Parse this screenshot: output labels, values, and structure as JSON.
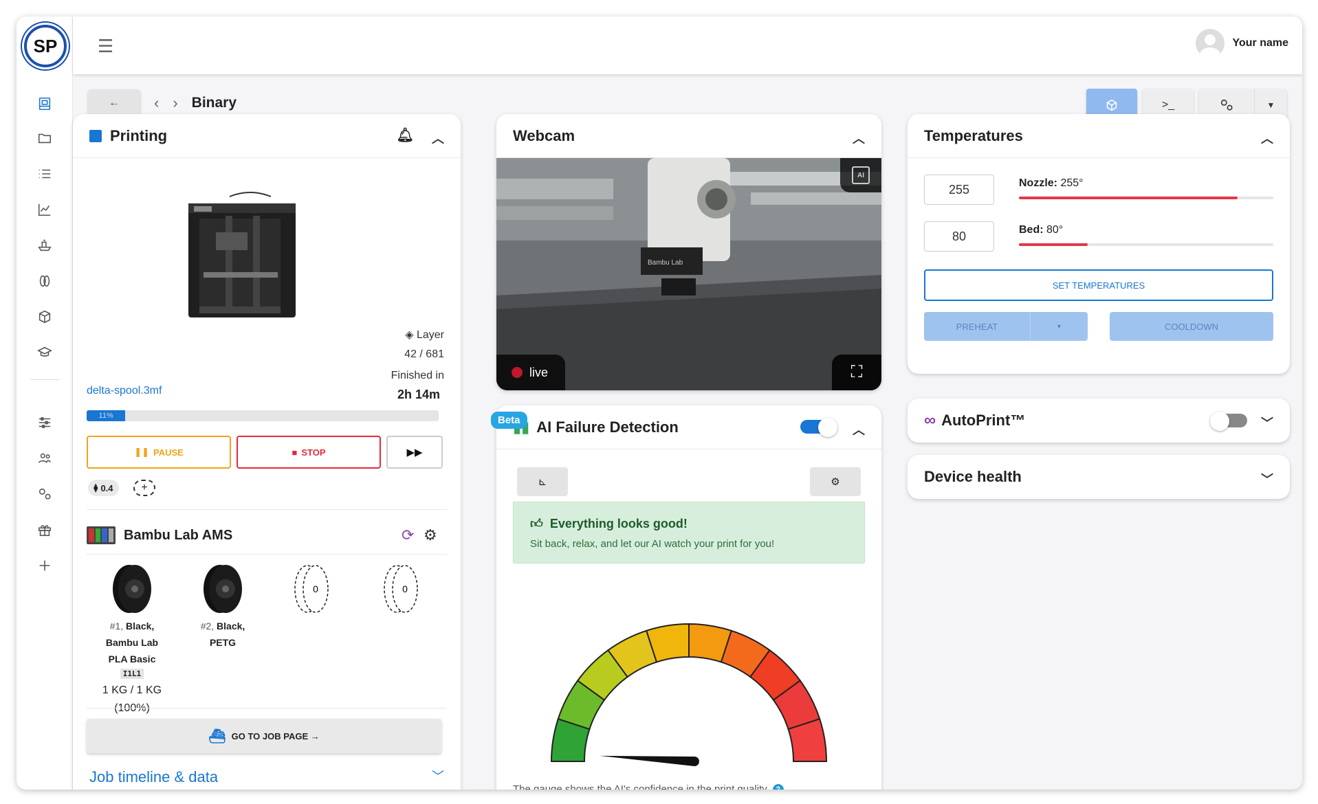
{
  "app": {
    "logo_text": "SP",
    "user_name": "Your name",
    "page_title": "Binary"
  },
  "sidebar": {
    "icons": [
      "printer-icon",
      "folder-icon",
      "list-icon",
      "chart-icon",
      "boat-icon",
      "filament-icon",
      "cube-icon",
      "graduation-cap-icon",
      "sliders-icon",
      "users-icon",
      "gears-icon",
      "gift-icon",
      "plus-icon"
    ]
  },
  "printing": {
    "title": "Printing",
    "layer_label": "Layer",
    "layer_value": "42 / 681",
    "finished_label": "Finished in",
    "finished_value": "2h 14m",
    "file_name": "delta-spool.3mf",
    "progress": 11,
    "progress_label": "11%",
    "pause_label": "PAUSE",
    "stop_label": "STOP",
    "nozzle_chip": "0.4",
    "ams_title": "Bambu Lab AMS",
    "spools": [
      {
        "slot": "#1,",
        "line1": "Black,",
        "line2": "Bambu Lab",
        "line3": "PLA Basic",
        "tag": "I1L1",
        "weight": "1 KG / 1 KG",
        "percent": "(100%)"
      },
      {
        "slot": "#2,",
        "line1": "Black,",
        "line2": "PETG"
      },
      {
        "slot": "",
        "label": "0"
      },
      {
        "slot": "",
        "label": "0"
      }
    ],
    "job_button": "GO TO JOB PAGE →",
    "timeline_label": "Job timeline & data"
  },
  "webcam": {
    "title": "Webcam",
    "live_label": "live",
    "ai_badge": "AI",
    "brand_text": "Bambu Lab"
  },
  "ai": {
    "beta_label": "Beta",
    "title": "AI Failure Detection",
    "good_title": "Everything looks good!",
    "good_text": "Sit back, relax, and let our AI watch your print for you!",
    "gauge_caption": "The gauge shows the AI's confidence in the print quality",
    "gauge_value": 0.02,
    "toggle_on": true
  },
  "temperatures": {
    "title": "Temperatures",
    "nozzle_input": "255",
    "nozzle_label": "Nozzle:",
    "nozzle_value": "255°",
    "nozzle_fill": 0.86,
    "bed_input": "80",
    "bed_label": "Bed:",
    "bed_value": "80°",
    "bed_fill": 0.27,
    "set_label": "SET TEMPERATURES",
    "preheat_label": "PREHEAT",
    "cooldown_label": "COOLDOWN"
  },
  "autoprint": {
    "title": "AutoPrint™",
    "toggle_on": false
  },
  "device_health": {
    "title": "Device health"
  },
  "colors": {
    "primary": "#1976d2",
    "pause": "#f2a31a",
    "stop": "#e02b3c",
    "good_bg": "#d7eedd",
    "good_text": "#1e5c2a"
  }
}
